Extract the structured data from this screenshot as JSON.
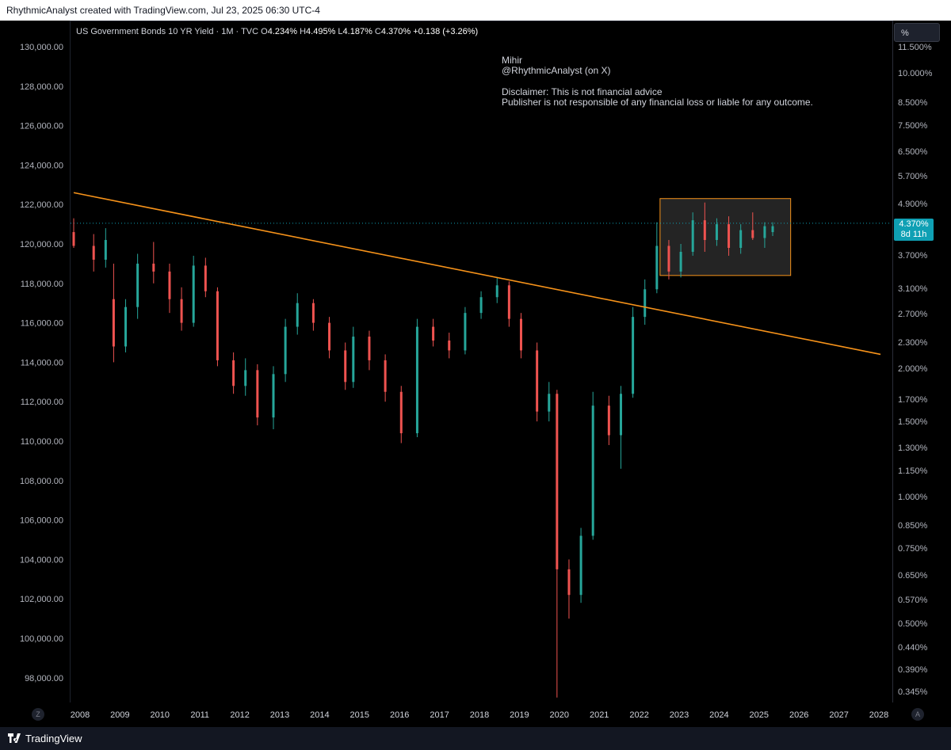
{
  "header": {
    "attribution": "RhythmicAnalyst created with TradingView.com, Jul 23, 2025 06:30 UTC-4"
  },
  "legend": {
    "symbol": "US Government Bonds 10 YR Yield · 1M · TVC",
    "o_label": "O",
    "o_value": "4.234%",
    "h_label": "H",
    "h_value": "4.495%",
    "l_label": "L",
    "l_value": "4.187%",
    "c_label": "C",
    "c_value": "4.370%",
    "change": "+0.138 (+3.26%)"
  },
  "note": {
    "line1": "Mihir",
    "line2": "@RhythmicAnalyst (on X)",
    "line3": "Disclaimer: This is not financial advice",
    "line4": "Publisher is not responsible of any financial loss or liable for any outcome."
  },
  "scale_button": "%",
  "last_price": {
    "value": "4.370%",
    "countdown": "8d 11h"
  },
  "axis_buttons": {
    "left": "Z",
    "right": "A"
  },
  "footer": {
    "brand": "TradingView"
  },
  "colors": {
    "up": "#26a69a",
    "down": "#ef5350",
    "trendline": "#f7931a",
    "box_border": "#f7931a",
    "box_fill": "#2a2a2a",
    "last_price": "#0fa0b4"
  },
  "chart_data": {
    "type": "candlestick",
    "title": "US Government Bonds 10 YR Yield · 1M · TVC",
    "left_axis": {
      "ticks": [
        "130,000.00",
        "128,000.00",
        "126,000.00",
        "124,000.00",
        "122,000.00",
        "120,000.00",
        "118,000.00",
        "116,000.00",
        "114,000.00",
        "112,000.00",
        "110,000.00",
        "108,000.00",
        "106,000.00",
        "104,000.00",
        "102,000.00",
        "100,000.00",
        "98,000.00"
      ],
      "range": [
        97000,
        131000
      ]
    },
    "right_axis": {
      "scale": "log",
      "ticks": [
        "11.500%",
        "10.000%",
        "8.500%",
        "7.500%",
        "6.500%",
        "5.700%",
        "4.900%",
        "4.300%",
        "3.700%",
        "3.100%",
        "2.700%",
        "2.300%",
        "2.000%",
        "1.700%",
        "1.500%",
        "1.300%",
        "1.150%",
        "1.000%",
        "0.850%",
        "0.750%",
        "0.650%",
        "0.570%",
        "0.500%",
        "0.440%",
        "0.390%",
        "0.345%"
      ]
    },
    "x_axis": {
      "ticks": [
        "2008",
        "2009",
        "2010",
        "2011",
        "2012",
        "2013",
        "2014",
        "2015",
        "2016",
        "2017",
        "2018",
        "2019",
        "2020",
        "2021",
        "2022",
        "2023",
        "2024",
        "2025",
        "2026",
        "2027",
        "2028"
      ]
    },
    "series": [
      {
        "year": 2008.0,
        "open": 120600,
        "high": 121300,
        "low": 119800,
        "close": 119900
      },
      {
        "year": 2008.5,
        "open": 119900,
        "high": 120500,
        "low": 118600,
        "close": 119200
      },
      {
        "year": 2008.8,
        "open": 119200,
        "high": 120800,
        "low": 118800,
        "close": 120200
      },
      {
        "year": 2009.0,
        "open": 117200,
        "high": 119000,
        "low": 114000,
        "close": 114800
      },
      {
        "year": 2009.3,
        "open": 114800,
        "high": 117200,
        "low": 114500,
        "close": 116800
      },
      {
        "year": 2009.6,
        "open": 116800,
        "high": 119500,
        "low": 116200,
        "close": 119000
      },
      {
        "year": 2010.0,
        "open": 119000,
        "high": 120100,
        "low": 118000,
        "close": 118600
      },
      {
        "year": 2010.4,
        "open": 118600,
        "high": 119000,
        "low": 116500,
        "close": 117200
      },
      {
        "year": 2010.7,
        "open": 117200,
        "high": 117800,
        "low": 115600,
        "close": 116000
      },
      {
        "year": 2011.0,
        "open": 116000,
        "high": 119400,
        "low": 115800,
        "close": 118900
      },
      {
        "year": 2011.3,
        "open": 118900,
        "high": 119300,
        "low": 117300,
        "close": 117600
      },
      {
        "year": 2011.6,
        "open": 117600,
        "high": 117800,
        "low": 113800,
        "close": 114100
      },
      {
        "year": 2012.0,
        "open": 114100,
        "high": 114500,
        "low": 112400,
        "close": 112800
      },
      {
        "year": 2012.3,
        "open": 112800,
        "high": 114200,
        "low": 112300,
        "close": 113600
      },
      {
        "year": 2012.6,
        "open": 113600,
        "high": 113900,
        "low": 110800,
        "close": 111200
      },
      {
        "year": 2013.0,
        "open": 111200,
        "high": 113800,
        "low": 110600,
        "close": 113400
      },
      {
        "year": 2013.3,
        "open": 113400,
        "high": 116200,
        "low": 113000,
        "close": 115800
      },
      {
        "year": 2013.6,
        "open": 115800,
        "high": 117500,
        "low": 115400,
        "close": 117000
      },
      {
        "year": 2014.0,
        "open": 117000,
        "high": 117200,
        "low": 115600,
        "close": 116000
      },
      {
        "year": 2014.4,
        "open": 116000,
        "high": 116300,
        "low": 114200,
        "close": 114600
      },
      {
        "year": 2014.8,
        "open": 114600,
        "high": 115000,
        "low": 112600,
        "close": 113000
      },
      {
        "year": 2015.0,
        "open": 113000,
        "high": 115800,
        "low": 112700,
        "close": 115300
      },
      {
        "year": 2015.4,
        "open": 115300,
        "high": 115600,
        "low": 113600,
        "close": 114100
      },
      {
        "year": 2015.8,
        "open": 114100,
        "high": 114400,
        "low": 112000,
        "close": 112500
      },
      {
        "year": 2016.2,
        "open": 112500,
        "high": 112800,
        "low": 109900,
        "close": 110400
      },
      {
        "year": 2016.6,
        "open": 110400,
        "high": 116200,
        "low": 110200,
        "close": 115800
      },
      {
        "year": 2017.0,
        "open": 115800,
        "high": 116200,
        "low": 114800,
        "close": 115100
      },
      {
        "year": 2017.4,
        "open": 115100,
        "high": 115500,
        "low": 114200,
        "close": 114600
      },
      {
        "year": 2017.8,
        "open": 114600,
        "high": 116800,
        "low": 114400,
        "close": 116500
      },
      {
        "year": 2018.2,
        "open": 116500,
        "high": 117600,
        "low": 116200,
        "close": 117300
      },
      {
        "year": 2018.6,
        "open": 117300,
        "high": 118300,
        "low": 117000,
        "close": 117900
      },
      {
        "year": 2018.9,
        "open": 117900,
        "high": 118100,
        "low": 115800,
        "close": 116200
      },
      {
        "year": 2019.2,
        "open": 116200,
        "high": 116500,
        "low": 114200,
        "close": 114600
      },
      {
        "year": 2019.6,
        "open": 114600,
        "high": 115000,
        "low": 111000,
        "close": 111500
      },
      {
        "year": 2019.9,
        "open": 111500,
        "high": 113000,
        "low": 111000,
        "close": 112400
      },
      {
        "year": 2020.1,
        "open": 112400,
        "high": 112600,
        "low": 97000,
        "close": 103500
      },
      {
        "year": 2020.4,
        "open": 103500,
        "high": 104000,
        "low": 101000,
        "close": 102200
      },
      {
        "year": 2020.7,
        "open": 102200,
        "high": 105600,
        "low": 101800,
        "close": 105200
      },
      {
        "year": 2021.0,
        "open": 105200,
        "high": 112500,
        "low": 105000,
        "close": 111800
      },
      {
        "year": 2021.4,
        "open": 111800,
        "high": 112300,
        "low": 109800,
        "close": 110300
      },
      {
        "year": 2021.7,
        "open": 110300,
        "high": 112800,
        "low": 108600,
        "close": 112400
      },
      {
        "year": 2022.0,
        "open": 112400,
        "high": 116800,
        "low": 112200,
        "close": 116300
      },
      {
        "year": 2022.3,
        "open": 116300,
        "high": 118200,
        "low": 115900,
        "close": 117700
      },
      {
        "year": 2022.6,
        "open": 117700,
        "high": 121100,
        "low": 117500,
        "close": 119900
      },
      {
        "year": 2022.9,
        "open": 119900,
        "high": 120200,
        "low": 118200,
        "close": 118600
      },
      {
        "year": 2023.2,
        "open": 118600,
        "high": 120000,
        "low": 118300,
        "close": 119600
      },
      {
        "year": 2023.5,
        "open": 119600,
        "high": 121600,
        "low": 119400,
        "close": 121200
      },
      {
        "year": 2023.8,
        "open": 121200,
        "high": 122100,
        "low": 119600,
        "close": 120200
      },
      {
        "year": 2024.1,
        "open": 120200,
        "high": 121300,
        "low": 119900,
        "close": 121000
      },
      {
        "year": 2024.4,
        "open": 121000,
        "high": 121400,
        "low": 119400,
        "close": 119800
      },
      {
        "year": 2024.7,
        "open": 119800,
        "high": 121000,
        "low": 119500,
        "close": 120700
      },
      {
        "year": 2025.0,
        "open": 120700,
        "high": 121600,
        "low": 120200,
        "close": 120300
      },
      {
        "year": 2025.3,
        "open": 120300,
        "high": 121100,
        "low": 119800,
        "close": 120900
      },
      {
        "year": 2025.5,
        "open": 120600,
        "high": 121100,
        "low": 120400,
        "close": 120900
      }
    ],
    "trendline": {
      "from": {
        "year": 2008.0,
        "value": 122600
      },
      "to": {
        "year": 2028.2,
        "value": 114400
      }
    },
    "range_box": {
      "from_year": 2022.68,
      "to_year": 2025.95,
      "top": 122300,
      "bottom": 118400
    },
    "last_price_line": 121050
  }
}
